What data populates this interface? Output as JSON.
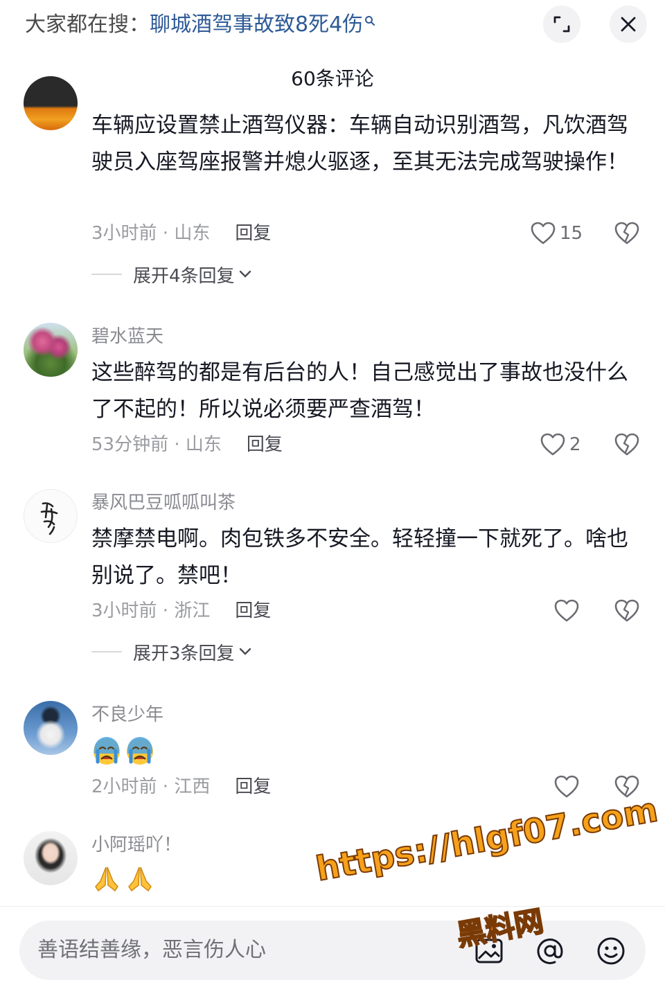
{
  "search": {
    "prefix": "大家都在搜：",
    "query": "聊城酒驾事故致8死4伤"
  },
  "header": {
    "comment_count": "60条评论"
  },
  "comments": [
    {
      "author": "",
      "text": "车辆应设置禁止酒驾仪器：车辆自动识别酒驾，凡饮酒驾驶员入座驾座报警并熄火驱逐，至其无法完成驾驶操作！",
      "time_location": "3小时前 · 山东",
      "reply_label": "回复",
      "likes": "15",
      "expand_label": "展开4条回复"
    },
    {
      "author": "碧水蓝天",
      "text": "这些醉驾的都是有后台的人！自己感觉出了事故也没什么了不起的！所以说必须要严查酒驾！",
      "time_location": "53分钟前 · 山东",
      "reply_label": "回复",
      "likes": "2"
    },
    {
      "author": "暴风巴豆呱呱叫茶",
      "text": "禁摩禁电啊。肉包铁多不安全。轻轻撞一下就死了。啥也别说了。禁吧！",
      "time_location": "3小时前 · 浙江",
      "reply_label": "回复",
      "likes": "",
      "expand_label": "展开3条回复"
    },
    {
      "author": "不良少年",
      "emojis": [
        "crying-face",
        "crying-face"
      ],
      "time_location": "2小时前 · 江西",
      "reply_label": "回复",
      "likes": ""
    },
    {
      "author": "小阿瑶吖！",
      "emojis": [
        "folded-hands",
        "folded-hands"
      ]
    }
  ],
  "bottom_bar": {
    "input_placeholder": "善语结善缘，恶言伤人心",
    "icons": [
      "image-icon",
      "at-icon",
      "emoji-icon"
    ]
  },
  "watermark": {
    "url": "https://hlgf07.com",
    "label": "黑料网"
  },
  "colors": {
    "search_query": "#2d5a96",
    "watermark": "#f6a11a",
    "meta_gray": "#9a9ba0"
  }
}
